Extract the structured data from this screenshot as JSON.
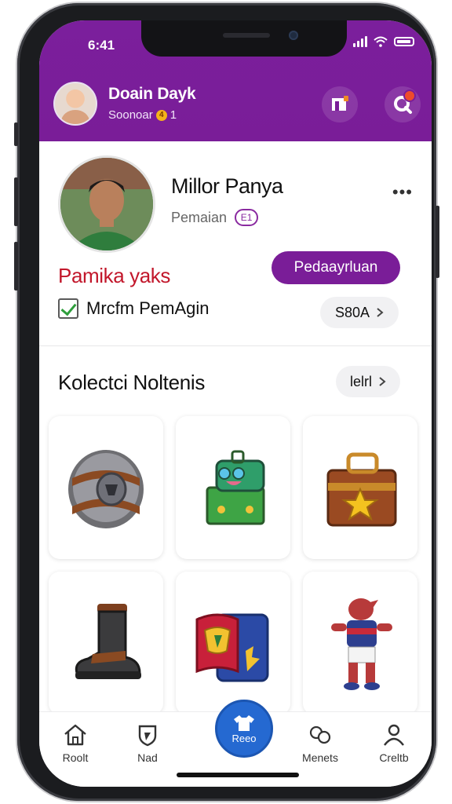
{
  "status_bar": {
    "time": "6:41"
  },
  "header": {
    "user_name": "Doain Dayk",
    "user_sub": "Soonoar",
    "coin_count": "1",
    "coin_symbol": "4"
  },
  "profile": {
    "name": "Millor Panya",
    "role": "Pemaian",
    "role_badge": "E1",
    "more": "•••",
    "highlight": "Pamika yaks",
    "primary_button": "Pedaayrluan",
    "checkbox_label": "Mrcfm PemAgin",
    "checkbox_checked": true,
    "side_pill": "S80A"
  },
  "collection": {
    "title": "Kolectci Noltenis",
    "see_all": "lelrl",
    "items": [
      {
        "icon": "metal-shield-icon"
      },
      {
        "icon": "robot-box-icon"
      },
      {
        "icon": "star-chest-icon"
      },
      {
        "icon": "boot-icon"
      },
      {
        "icon": "jersey-pack-icon"
      },
      {
        "icon": "mascot-player-icon"
      }
    ]
  },
  "tabbar": {
    "tabs": [
      {
        "label": "Roolt",
        "icon": "home-icon"
      },
      {
        "label": "Nad",
        "icon": "badge-icon"
      },
      {
        "label": "Reeo",
        "icon": "shirt-icon"
      },
      {
        "label": "Menets",
        "icon": "chat-icon"
      },
      {
        "label": "Creltb",
        "icon": "profile-icon"
      }
    ]
  },
  "colors": {
    "brand_purple": "#7a1d98",
    "accent_red": "#c2172b",
    "fab_blue": "#2569d1"
  }
}
